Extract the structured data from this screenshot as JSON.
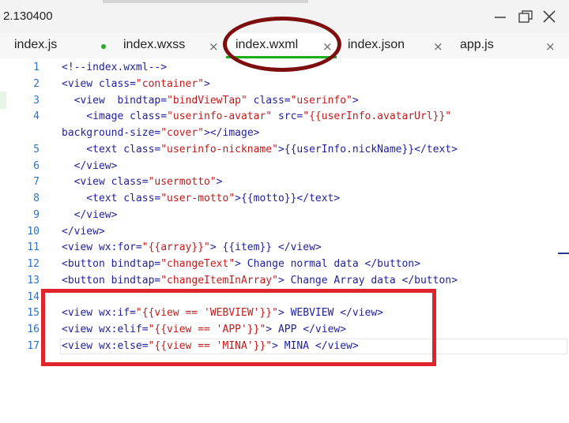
{
  "window": {
    "title": "2.130400",
    "controls": {
      "minimize_icon": "minimize-icon",
      "maximize_icon": "maximize-icon",
      "close_icon": "close-icon"
    }
  },
  "tabs": [
    {
      "label": "index.js",
      "close": "",
      "modified": true,
      "active": false
    },
    {
      "label": "index.wxss",
      "close": "×",
      "modified": false,
      "active": false
    },
    {
      "label": "index.wxml",
      "close": "×",
      "modified": false,
      "active": true
    },
    {
      "label": "index.json",
      "close": "×",
      "modified": false,
      "active": false
    },
    {
      "label": "app.js",
      "close": "×",
      "modified": false,
      "active": false
    }
  ],
  "editor": {
    "lines": [
      {
        "num": "1",
        "text": "<!--index.wxml-->"
      },
      {
        "num": "2",
        "text": "<view class=\"container\">"
      },
      {
        "num": "3",
        "text": "  <view  bindtap=\"bindViewTap\" class=\"userinfo\">"
      },
      {
        "num": "4",
        "text": "    <image class=\"userinfo-avatar\" src=\"{{userInfo.avatarUrl}}\""
      },
      {
        "num": "",
        "text": "background-size=\"cover\"></image>"
      },
      {
        "num": "5",
        "text": "    <text class=\"userinfo-nickname\">{{userInfo.nickName}}</text>"
      },
      {
        "num": "6",
        "text": "  </view>"
      },
      {
        "num": "7",
        "text": "  <view class=\"usermotto\">"
      },
      {
        "num": "8",
        "text": "    <text class=\"user-motto\">{{motto}}</text>"
      },
      {
        "num": "9",
        "text": "  </view>"
      },
      {
        "num": "10",
        "text": "</view>"
      },
      {
        "num": "11",
        "text": "<view wx:for=\"{{array}}\"> {{item}} </view>"
      },
      {
        "num": "12",
        "text": "<button bindtap=\"changeText\"> Change normal data </button>"
      },
      {
        "num": "13",
        "text": "<button bindtap=\"changeItemInArray\"> Change Array data </button>"
      },
      {
        "num": "14",
        "text": ""
      },
      {
        "num": "15",
        "text": "<view wx:if=\"{{view == 'WEBVIEW'}}\"> WEBVIEW </view>"
      },
      {
        "num": "16",
        "text": "<view wx:elif=\"{{view == 'APP'}}\"> APP </view>"
      },
      {
        "num": "17",
        "text": "<view wx:else=\"{{view == 'MINA'}}\"> MINA </view>"
      }
    ]
  },
  "colors": {
    "keyword": "#1f1f9e",
    "string": "#c21a1a",
    "comment": "#1f1f9e",
    "line_number": "#2b73c9",
    "active_tab_indicator": "#1aad19",
    "annotation_circle": "#7d0e0e",
    "annotation_rect": "#e0242b"
  }
}
